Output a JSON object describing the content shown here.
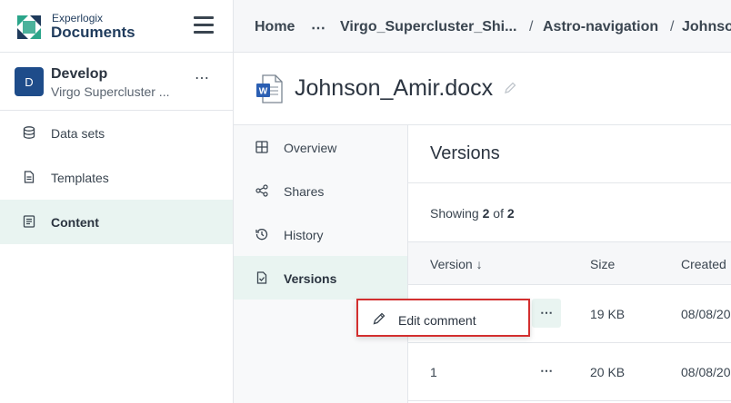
{
  "brand": {
    "top": "Experlogix",
    "bottom": "Documents"
  },
  "workspace": {
    "initial": "D",
    "name": "Develop",
    "subtitle": "Virgo Supercluster ...",
    "more": "⋯"
  },
  "sidebar": {
    "items": [
      {
        "label": "Data sets",
        "icon": "database-icon"
      },
      {
        "label": "Templates",
        "icon": "document-icon"
      },
      {
        "label": "Content",
        "icon": "content-icon",
        "active": true
      }
    ]
  },
  "breadcrumb": {
    "items": [
      "Home",
      "⋯",
      "Virgo_Supercluster_Shi...",
      "Astro-navigation",
      "Johnson"
    ],
    "separator": "/"
  },
  "document": {
    "title": "Johnson_Amir.docx",
    "type_icon": "word-icon"
  },
  "subnav": {
    "items": [
      {
        "label": "Overview",
        "icon": "grid-icon"
      },
      {
        "label": "Shares",
        "icon": "share-icon"
      },
      {
        "label": "History",
        "icon": "history-icon"
      },
      {
        "label": "Versions",
        "icon": "versions-icon",
        "active": true
      }
    ]
  },
  "versions": {
    "title": "Versions",
    "showing_prefix": "Showing",
    "showing_count": "2",
    "showing_of": "of",
    "showing_total": "2",
    "columns": {
      "version": "Version ↓",
      "size": "Size",
      "created": "Created"
    },
    "rows": [
      {
        "version": "",
        "more": "⋯",
        "size": "19 KB",
        "created": "08/08/20"
      },
      {
        "version": "1",
        "more": "⋯",
        "size": "20 KB",
        "created": "08/08/20"
      }
    ]
  },
  "context_menu": {
    "edit_comment": "Edit comment"
  },
  "colors": {
    "accent": "#e9f4f1",
    "brand_blue": "#1e4c8a",
    "highlight_border": "#d32f2f"
  }
}
